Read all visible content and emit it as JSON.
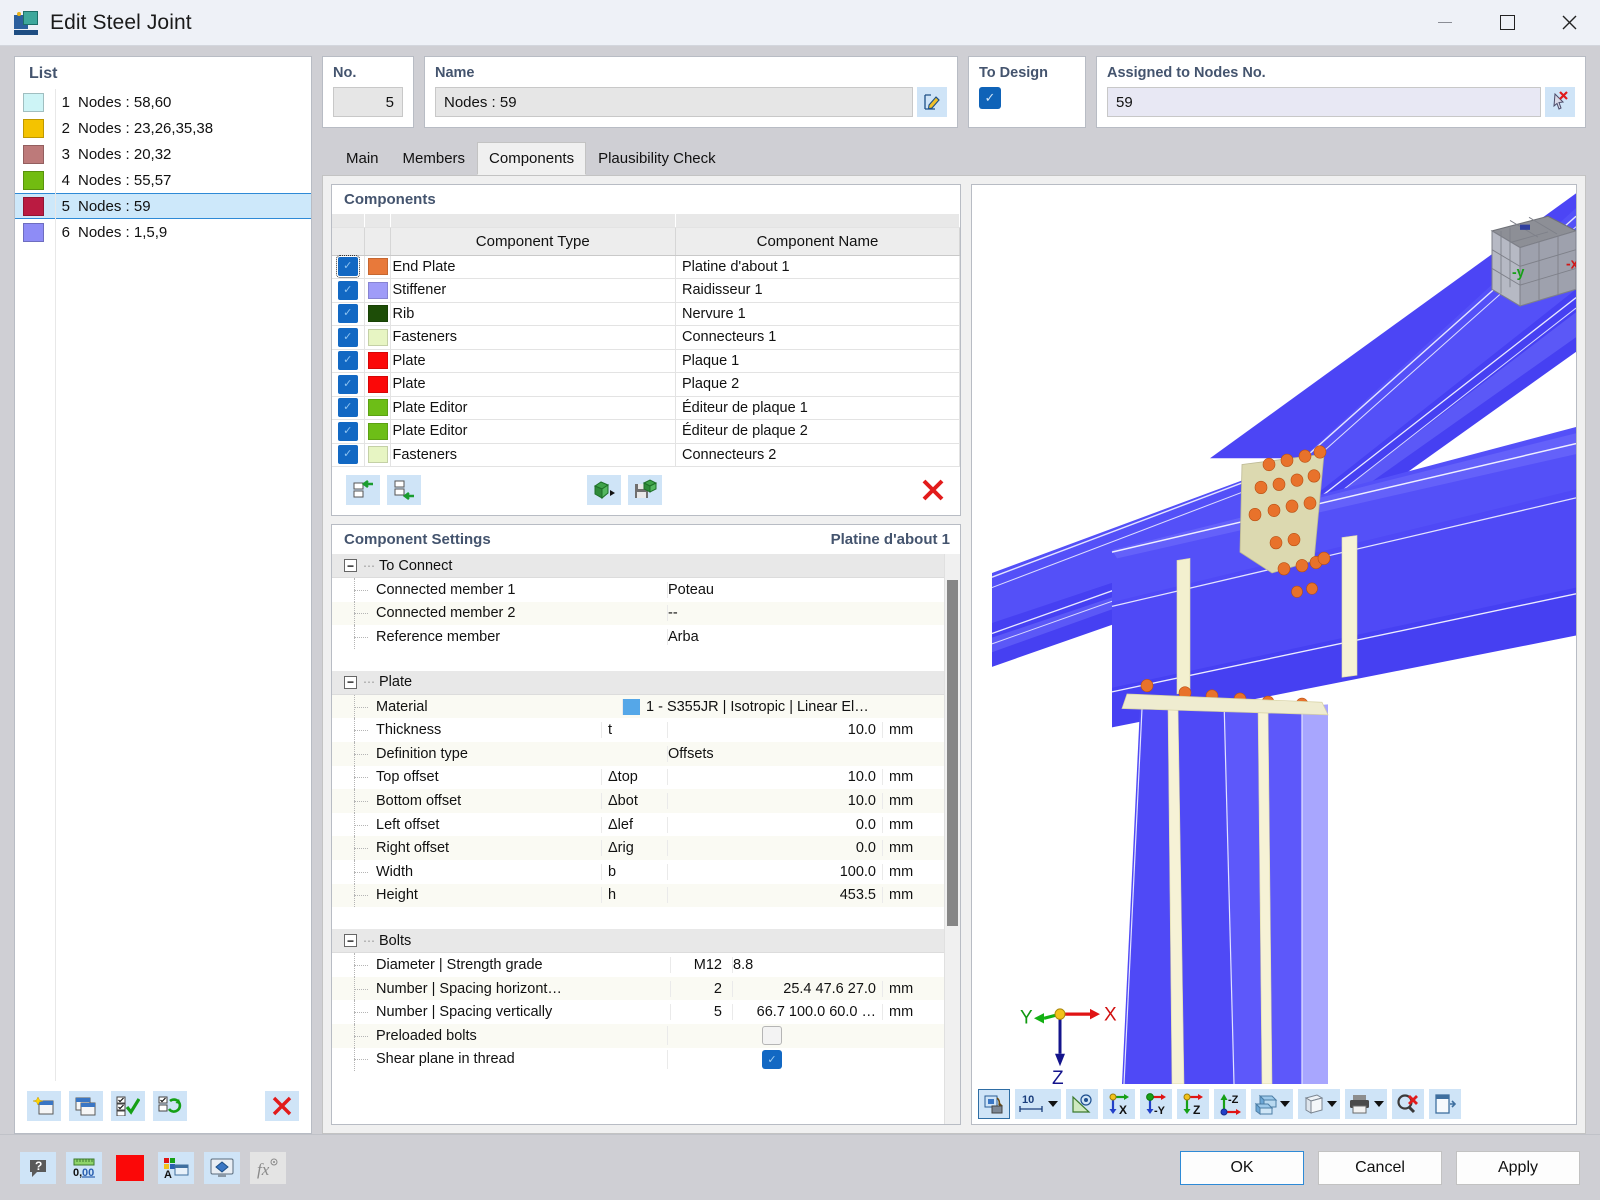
{
  "window": {
    "title": "Edit Steel Joint",
    "app_icon": "steel-joint-icon",
    "minimize": "—",
    "maximize": "□",
    "close": "✕"
  },
  "list_panel": {
    "header": "List",
    "rows": [
      {
        "no": "1",
        "label": "Nodes : 58,60",
        "color": "#cdf4f6"
      },
      {
        "no": "2",
        "label": "Nodes : 23,26,35,38",
        "color": "#f4c300"
      },
      {
        "no": "3",
        "label": "Nodes : 20,32",
        "color": "#bd7a7a"
      },
      {
        "no": "4",
        "label": "Nodes : 55,57",
        "color": "#72bc11"
      },
      {
        "no": "5",
        "label": "Nodes : 59",
        "color": "#ba1b41"
      },
      {
        "no": "6",
        "label": "Nodes : 1,5,9",
        "color": "#8e8cf6"
      }
    ],
    "selected_index": 4,
    "footer_buttons": [
      {
        "name": "new-joint-button",
        "icon": "new-window-icon"
      },
      {
        "name": "copy-joint-button",
        "icon": "copy-window-icon"
      },
      {
        "name": "select-all-button",
        "icon": "checkbox-check-icon"
      },
      {
        "name": "invert-selection-button",
        "icon": "checkbox-refresh-icon"
      },
      {
        "name": "delete-joint-button",
        "icon": "red-x-icon"
      }
    ]
  },
  "header_fields": {
    "no": {
      "label": "No.",
      "value": "5"
    },
    "name": {
      "label": "Name",
      "value": "Nodes : 59",
      "edit_icon": "edit-pencil-icon"
    },
    "to_design": {
      "label": "To Design",
      "checked": true
    },
    "assigned_nodes": {
      "label": "Assigned to Nodes No.",
      "value": "59",
      "pick_icon": "pick-cursor-icon"
    }
  },
  "tabs": {
    "items": [
      "Main",
      "Members",
      "Components",
      "Plausibility Check"
    ],
    "active": "Components"
  },
  "components_panel": {
    "title": "Components",
    "columns": [
      "Component Type",
      "Component Name"
    ],
    "rows": [
      {
        "checked": true,
        "color": "#e8793a",
        "type": "End Plate",
        "name": "Platine d'about 1"
      },
      {
        "checked": true,
        "color": "#9f9cf8",
        "type": "Stiffener",
        "name": "Raidisseur 1"
      },
      {
        "checked": true,
        "color": "#1d4d07",
        "type": "Rib",
        "name": "Nervure 1"
      },
      {
        "checked": true,
        "color": "#e7f5c3",
        "type": "Fasteners",
        "name": "Connecteurs 1"
      },
      {
        "checked": true,
        "color": "#fb0808",
        "type": "Plate",
        "name": "Plaque 1"
      },
      {
        "checked": true,
        "color": "#fb0808",
        "type": "Plate",
        "name": "Plaque 2"
      },
      {
        "checked": true,
        "color": "#6dbe17",
        "type": "Plate Editor",
        "name": "Éditeur de plaque 1"
      },
      {
        "checked": true,
        "color": "#6dbe17",
        "type": "Plate Editor",
        "name": "Éditeur de plaque 2"
      },
      {
        "checked": true,
        "color": "#e7f5c3",
        "type": "Fasteners",
        "name": "Connecteurs 2"
      }
    ],
    "toolbar_buttons": [
      {
        "name": "move-component-up-button",
        "icon": "arrow-left-insert-icon"
      },
      {
        "name": "move-component-down-button",
        "icon": "arrow-left-append-icon"
      },
      {
        "name": "import-component-button",
        "icon": "green-box-arrow-icon"
      },
      {
        "name": "save-component-button",
        "icon": "green-box-save-icon"
      },
      {
        "name": "delete-component-button",
        "icon": "red-x-icon"
      }
    ]
  },
  "component_settings": {
    "title": "Component Settings",
    "subject": "Platine d'about 1",
    "groups": [
      {
        "name": "To Connect",
        "rows": [
          {
            "label": "Connected member 1",
            "symbol": "",
            "value": "Poteau",
            "unit": "",
            "align": "left"
          },
          {
            "label": "Connected member 2",
            "symbol": "",
            "value": "--",
            "unit": "",
            "align": "left"
          },
          {
            "label": "Reference member",
            "symbol": "",
            "value": "Arba",
            "unit": "",
            "align": "left"
          }
        ]
      },
      {
        "name": "Plate",
        "rows": [
          {
            "label": "Material",
            "symbol": "",
            "value": "1 - S355JR | Isotropic | Linear El…",
            "unit": "",
            "align": "left",
            "swatch": "#55a7e8"
          },
          {
            "label": "Thickness",
            "symbol": "t",
            "value": "10.0",
            "unit": "mm",
            "align": "right"
          },
          {
            "label": "Definition type",
            "symbol": "",
            "value": "Offsets",
            "unit": "",
            "align": "left"
          },
          {
            "label": "Top offset",
            "symbol": "Δtop",
            "value": "10.0",
            "unit": "mm",
            "align": "right"
          },
          {
            "label": "Bottom offset",
            "symbol": "Δbot",
            "value": "10.0",
            "unit": "mm",
            "align": "right"
          },
          {
            "label": "Left offset",
            "symbol": "Δlef",
            "value": "0.0",
            "unit": "mm",
            "align": "right"
          },
          {
            "label": "Right offset",
            "symbol": "Δrig",
            "value": "0.0",
            "unit": "mm",
            "align": "right"
          },
          {
            "label": "Width",
            "symbol": "b",
            "value": "100.0",
            "unit": "mm",
            "align": "right"
          },
          {
            "label": "Height",
            "symbol": "h",
            "value": "453.5",
            "unit": "mm",
            "align": "right"
          }
        ]
      },
      {
        "name": "Bolts",
        "rows": [
          {
            "label": "Diameter | Strength grade",
            "symbol": "",
            "num": "M12",
            "value": "8.8",
            "unit": "",
            "align": "left"
          },
          {
            "label": "Number | Spacing horizont…",
            "symbol": "",
            "num": "2",
            "value": "25.4 47.6 27.0",
            "unit": "mm",
            "align": "right"
          },
          {
            "label": "Number | Spacing vertically",
            "symbol": "",
            "num": "5",
            "value": "66.7 100.0 60.0 …",
            "unit": "mm",
            "align": "right"
          },
          {
            "label": "Preloaded bolts",
            "symbol": "",
            "checkbox": false
          },
          {
            "label": "Shear plane in thread",
            "symbol": "",
            "checkbox": true
          }
        ]
      }
    ]
  },
  "viewport": {
    "axis_labels": {
      "x": "X",
      "y": "Y",
      "z": "Z"
    },
    "cube_faces": {
      "left": "-y",
      "right": "-x"
    },
    "zoom_value": "10",
    "toolbar_buttons": [
      {
        "name": "render-mode-button",
        "icon": "render-toggle-icon",
        "selected": true
      },
      {
        "name": "scale-dropdown",
        "icon": "scale-icon",
        "label": "10",
        "has_caret": true
      },
      {
        "name": "measure-button",
        "icon": "measure-ruler-icon"
      },
      {
        "name": "view-x-button",
        "icon": "axis-x-icon"
      },
      {
        "name": "view-negy-button",
        "icon": "axis-negy-icon"
      },
      {
        "name": "view-z-button",
        "icon": "axis-z-icon"
      },
      {
        "name": "view-negz-button",
        "icon": "axis-negz-icon"
      },
      {
        "name": "surface-display-dropdown",
        "icon": "solid-blocks-icon",
        "has_caret": true
      },
      {
        "name": "wireframe-dropdown",
        "icon": "wireframe-cube-icon",
        "has_caret": true
      },
      {
        "name": "print-dropdown",
        "icon": "printer-icon",
        "has_caret": true
      },
      {
        "name": "reset-view-button",
        "icon": "magnifier-x-icon"
      },
      {
        "name": "detach-view-button",
        "icon": "window-detach-icon"
      }
    ]
  },
  "bottom_bar": {
    "buttons": [
      {
        "name": "help-button",
        "icon": "question-bubble-icon"
      },
      {
        "name": "units-button",
        "icon": "units-0-00-icon"
      },
      {
        "name": "color-button",
        "icon": "red-color-swatch-icon"
      },
      {
        "name": "display-properties-button",
        "icon": "color-palette-window-icon"
      },
      {
        "name": "visual-settings-button",
        "icon": "monitor-diamond-icon"
      },
      {
        "name": "formula-button",
        "icon": "fx-icon"
      }
    ],
    "ok": "OK",
    "cancel": "Cancel",
    "apply": "Apply"
  }
}
